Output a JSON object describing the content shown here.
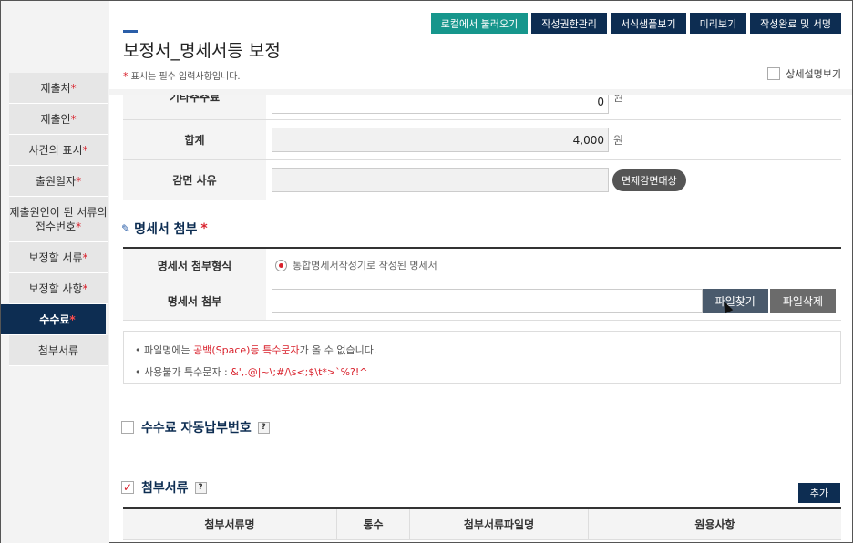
{
  "sidebar": {
    "items": [
      {
        "label": "제출처",
        "required": "*"
      },
      {
        "label": "제출인",
        "required": "*"
      },
      {
        "label": "사건의 표시",
        "required": "*"
      },
      {
        "label": "출원일자",
        "required": "*"
      },
      {
        "label": "제출원인이 된 서류의 접수번호",
        "required": "*"
      },
      {
        "label": "보정할 서류",
        "required": "*"
      },
      {
        "label": "보정할 사항",
        "required": "*"
      },
      {
        "label": "수수료",
        "required": "*"
      },
      {
        "label": "첨부서류",
        "required": ""
      }
    ]
  },
  "header": {
    "title": "보정서_명세서등 보정",
    "req_star": "*",
    "req_note": " 표시는 필수 입력사항입니다.",
    "buttons": [
      "로컬에서 불러오기",
      "작성권한관리",
      "서식샘플보기",
      "미리보기",
      "작성완료 및 서명"
    ],
    "detail_toggle": "상세설명보기"
  },
  "fee": {
    "other_label": "기타수수료",
    "other_value": "0",
    "other_unit": "원",
    "total_label": "합계",
    "total_value": "4,000",
    "total_unit": "원",
    "reason_label": "감면 사유",
    "reason_button": "면제감면대상"
  },
  "attach": {
    "section_title": "명세서 첨부",
    "section_star": "*",
    "format_label": "명세서 첨부형식",
    "format_option": "통합명세서작성기로 작성된 명세서",
    "file_label": "명세서 첨부",
    "find_button": "파일찾기",
    "delete_button": "파일삭제"
  },
  "notice": {
    "line1_pre": "파일명에는 ",
    "line1_red": "공백(Space)등 특수문자",
    "line1_post": "가 올 수 없습니다.",
    "line2_pre": "사용불가 특수문자 : ",
    "line2_red": "&',.@|~\\;#/\\s<;$\\t*>`%?!^"
  },
  "autopay": {
    "title": "수수료 자동납부번호",
    "help": "?"
  },
  "docs": {
    "title": "첨부서류",
    "help": "?",
    "check": "✓",
    "add_button": "추가",
    "columns": [
      "첨부서류명",
      "통수",
      "첨부서류파일명",
      "원용사항"
    ]
  }
}
